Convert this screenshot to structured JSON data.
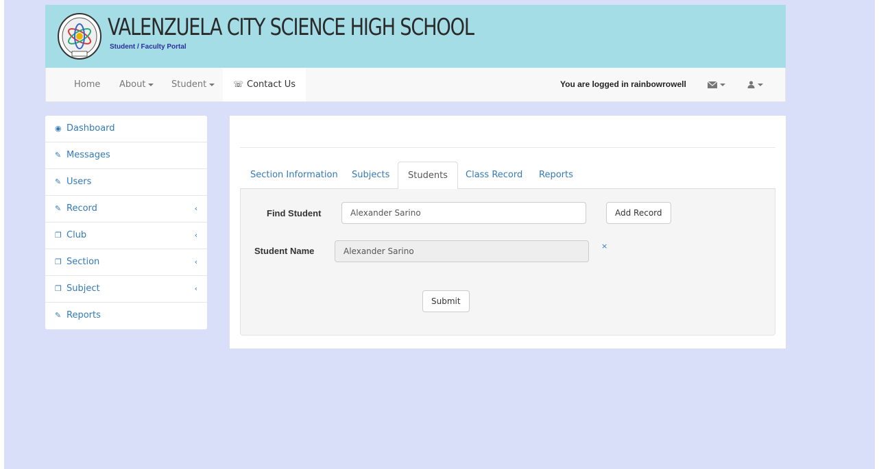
{
  "header": {
    "school_name": "VALENZUELA CITY SCIENCE HIGH SCHOOL",
    "portal_subtitle": "Student / Faculty Portal",
    "logo_icon": "school-seal-icon"
  },
  "navbar": {
    "home": "Home",
    "about": "About",
    "student": "Student",
    "contact": "Contact Us",
    "logged_in": "You are logged in rainbowrowell",
    "mail_icon": "envelope-icon",
    "user_icon": "user-icon"
  },
  "sidebar": {
    "items": [
      {
        "label": "Dashboard",
        "icon": "dashboard-icon"
      },
      {
        "label": "Messages",
        "icon": "edit-icon"
      },
      {
        "label": "Users",
        "icon": "edit-icon"
      },
      {
        "label": "Record",
        "icon": "edit-icon"
      },
      {
        "label": "Club",
        "icon": "copy-icon"
      },
      {
        "label": "Section",
        "icon": "copy-icon"
      },
      {
        "label": "Subject",
        "icon": "copy-icon"
      },
      {
        "label": "Reports",
        "icon": "edit-icon"
      }
    ]
  },
  "tabs": [
    {
      "label": "Section Information"
    },
    {
      "label": "Subjects"
    },
    {
      "label": "Students"
    },
    {
      "label": "Class Record"
    },
    {
      "label": "Reports"
    }
  ],
  "form": {
    "find_label": "Find Student",
    "find_value": "Alexander Sarino",
    "add_button": "Add Record",
    "name_label": "Student Name",
    "name_value": "Alexander Sarino",
    "clear": "×",
    "submit_button": "Submit"
  },
  "colors": {
    "banner": "#a5dde6",
    "page_background": "#dadff9",
    "link": "#337ab7"
  }
}
